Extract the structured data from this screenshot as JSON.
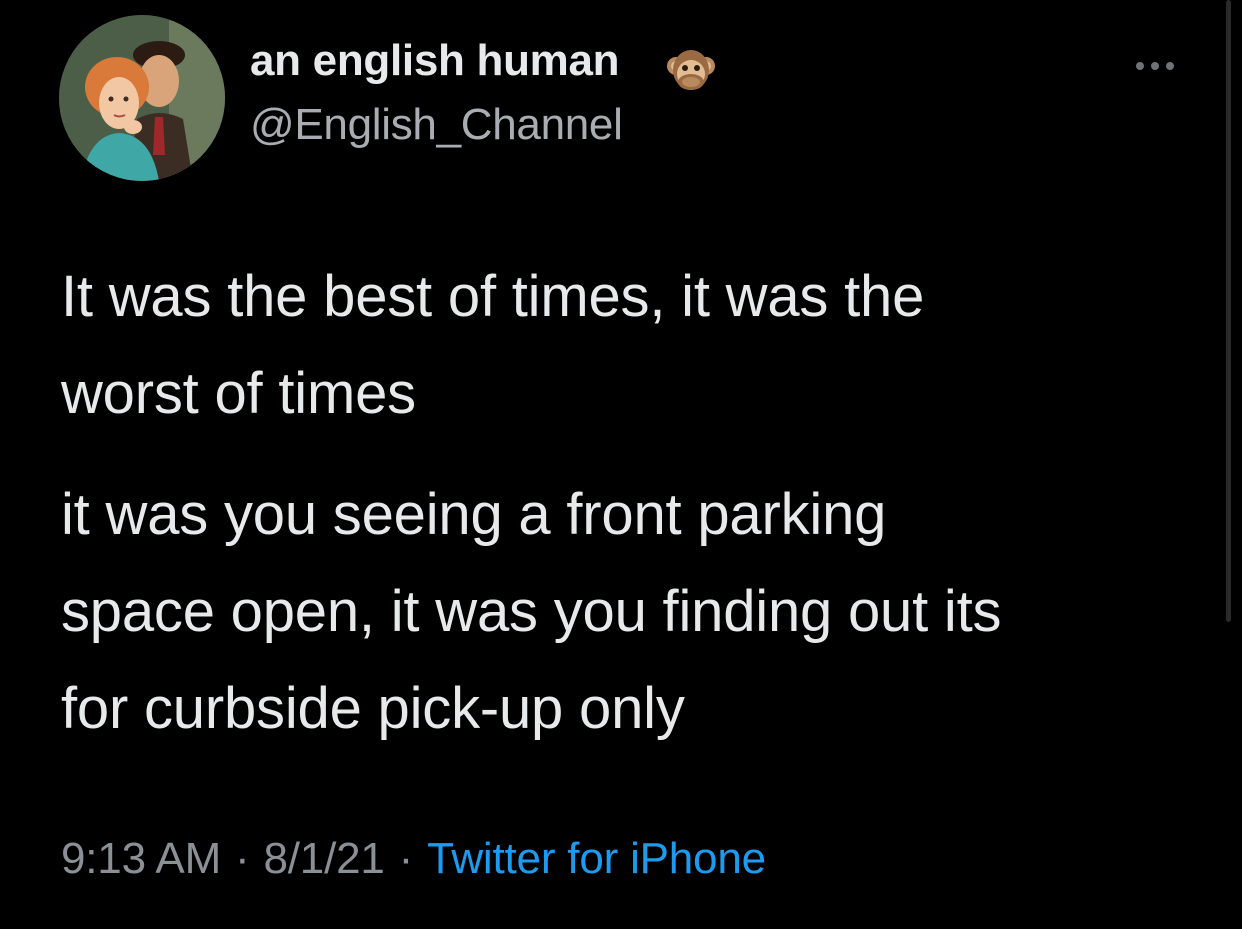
{
  "author": {
    "display_name": "an english human",
    "handle": "@English_Channel",
    "name_emoji": "see-no-evil-monkey-icon"
  },
  "tweet": {
    "paragraph_1": {
      "lines": [
        "It was the best of times, it was the",
        "worst of times"
      ]
    },
    "paragraph_2": {
      "lines": [
        "it was you seeing a front parking",
        "space open, it was you finding out its",
        "for curbside pick-up only"
      ]
    },
    "time": "9:13 AM",
    "separator": "·",
    "date": "8/1/21",
    "source": "Twitter for iPhone"
  },
  "icons": {
    "more": "more-options-icon"
  },
  "colors": {
    "background": "#000000",
    "text_primary": "#e7e9ea",
    "text_secondary": "#8b9096",
    "link": "#1d9bf0"
  }
}
